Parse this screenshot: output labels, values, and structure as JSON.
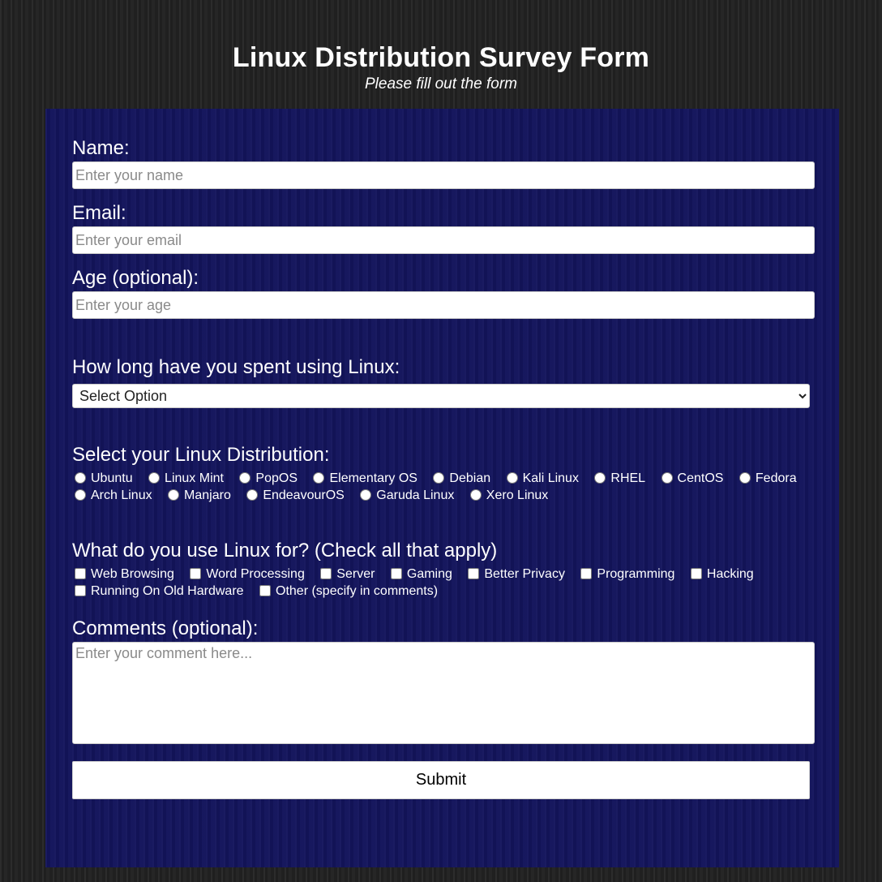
{
  "header": {
    "title": "Linux Distribution Survey Form",
    "subtitle": "Please fill out the form"
  },
  "form": {
    "name": {
      "label": "Name:",
      "placeholder": "Enter your name",
      "value": ""
    },
    "email": {
      "label": "Email:",
      "placeholder": "Enter your email",
      "value": ""
    },
    "age": {
      "label": "Age (optional):",
      "placeholder": "Enter your age",
      "value": ""
    },
    "duration": {
      "label": "How long have you spent using Linux:",
      "selected": "Select Option"
    },
    "distro": {
      "label": "Select your Linux Distribution:",
      "options": [
        "Ubuntu",
        "Linux Mint",
        "PopOS",
        "Elementary OS",
        "Debian",
        "Kali Linux",
        "RHEL",
        "CentOS",
        "Fedora",
        "Arch Linux",
        "Manjaro",
        "EndeavourOS",
        "Garuda Linux",
        "Xero Linux"
      ]
    },
    "usage": {
      "label": "What do you use Linux for? (Check all that apply)",
      "options": [
        "Web Browsing",
        "Word Processing",
        "Server",
        "Gaming",
        "Better Privacy",
        "Programming",
        "Hacking",
        "Running On Old Hardware",
        "Other (specify in comments)"
      ]
    },
    "comments": {
      "label": "Comments (optional):",
      "placeholder": "Enter your comment here...",
      "value": ""
    },
    "submit_label": "Submit"
  },
  "colors": {
    "form_background": "#13145c",
    "page_background": "#222222",
    "text": "#ffffff"
  }
}
